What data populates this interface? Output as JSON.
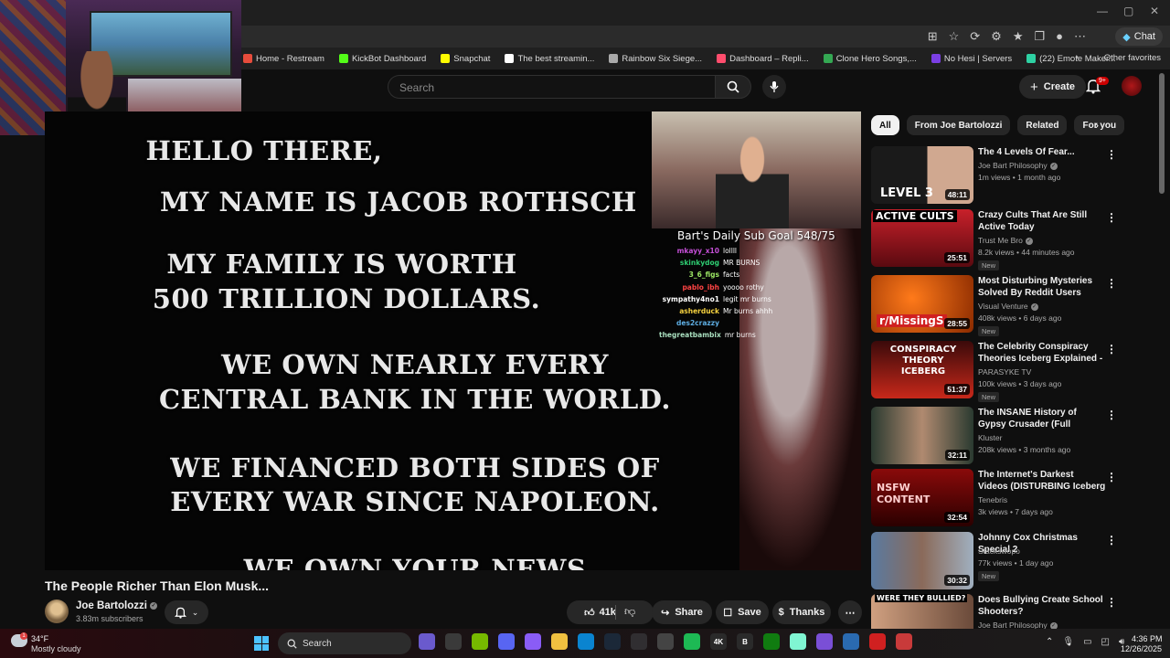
{
  "browser": {
    "chat_label": "Chat",
    "bookmarks": [
      {
        "label": "Home - Restream",
        "color": "#e74c3c"
      },
      {
        "label": "KickBot Dashboard",
        "color": "#53fc18"
      },
      {
        "label": "Snapchat",
        "color": "#fffc00"
      },
      {
        "label": "The best streamin...",
        "color": "#ffffff"
      },
      {
        "label": "Rainbow Six Siege...",
        "color": "#aaaaaa"
      },
      {
        "label": "Dashboard – Repli...",
        "color": "#ff4d6d"
      },
      {
        "label": "Clone Hero Songs,...",
        "color": "#34a853"
      },
      {
        "label": "No Hesi | Servers",
        "color": "#7b3fe4"
      },
      {
        "label": "(22) Emote Maker...",
        "color": "#2ed1a3"
      }
    ],
    "other_favorites": "Other favorites"
  },
  "header": {
    "search_placeholder": "Search",
    "create_label": "Create",
    "notif_count": "9+"
  },
  "video": {
    "lines": [
      "HELLO THERE,",
      "MY NAME IS JACOB ROTHSCH",
      "MY FAMILY IS WORTH",
      "500 TRILLION DOLLARS.",
      "WE OWN NEARLY EVERY",
      "CENTRAL BANK IN THE WORLD.",
      "WE FINANCED BOTH SIDES OF",
      "EVERY WAR SINCE NAPOLEON.",
      "WE OWN YOUR NEWS"
    ],
    "sub_goal": "Bart's Daily Sub Goal 548/75",
    "chat": [
      {
        "user": "mkayy_x10",
        "msg": "lollll",
        "color": "#c44fd6"
      },
      {
        "user": "skinkydog",
        "msg": "MR BURNS",
        "color": "#2ecc71"
      },
      {
        "user": "3_6_figs",
        "msg": "facts",
        "color": "#9be564"
      },
      {
        "user": "pablo_ibh",
        "msg": "yoooo rothy",
        "color": "#ff4444"
      },
      {
        "user": "sympathy4no1",
        "msg": "legit mr burns",
        "color": "#ffffff"
      },
      {
        "user": "asherduck",
        "msg": "Mr burns ahhh",
        "color": "#f4d03f"
      },
      {
        "user": "des2crazzy",
        "msg": "",
        "color": "#5dade2"
      },
      {
        "user": "thegreatbambix",
        "msg": "mr burns",
        "color": "#a9dfbf"
      }
    ],
    "title": "The People Richer Than Elon Musk...",
    "channel": "Joe Bartolozzi",
    "subscribers": "3.83m subscribers",
    "likes": "41k",
    "share": "Share",
    "save": "Save",
    "thanks": "Thanks"
  },
  "sidebar": {
    "chips": [
      "All",
      "From Joe Bartolozzi",
      "Related",
      "For you"
    ],
    "recs": [
      {
        "title": "The 4 Levels Of Fear...",
        "channel": "Joe Bart Philosophy",
        "verified": true,
        "meta": "1m views • 1 month ago",
        "duration": "48:11",
        "new": "",
        "thumb_text": "LEVEL 3",
        "thumb_bg": "linear-gradient(90deg,#1a1a1a 0 55%,#d0a890 55%)"
      },
      {
        "title": "Crazy Cults That Are Still Active Today",
        "channel": "Trust Me Bro",
        "verified": true,
        "meta": "8.2k views • 44 minutes ago",
        "duration": "25:51",
        "new": "New",
        "thumb_text": "ACTIVE CULTS",
        "thumb_bg": "linear-gradient(180deg,#c8202a,#5a0a10)"
      },
      {
        "title": "Most Disturbing Mysteries Solved By Reddit Users",
        "channel": "Visual Venture",
        "verified": true,
        "meta": "408k views • 6 days ago",
        "duration": "28:55",
        "new": "New",
        "thumb_text": "r/MissingS",
        "thumb_bg": "radial-gradient(circle at 40% 40%,#ff7a1a,#8a2a00)"
      },
      {
        "title": "The Celebrity Conspiracy Theories Iceberg Explained - ...",
        "channel": "PARASYKE TV",
        "verified": false,
        "meta": "100k views • 3 days ago",
        "duration": "51:37",
        "new": "New",
        "thumb_text": "CONSPIRACY THEORY ICEBERG",
        "thumb_bg": "linear-gradient(180deg,#3a0a0a,#c8281a)"
      },
      {
        "title": "The INSANE History of Gypsy Crusader (Full Documentary)",
        "channel": "Kluster",
        "verified": false,
        "meta": "208k views • 3 months ago",
        "duration": "32:11",
        "new": "",
        "thumb_text": "",
        "thumb_bg": "linear-gradient(90deg,#2a3a30,#b08a70,#2a3a30)"
      },
      {
        "title": "The Internet's Darkest Videos (DISTURBING Iceberg List)",
        "channel": "Tenebris",
        "verified": false,
        "meta": "3k views • 7 days ago",
        "duration": "32:54",
        "new": "",
        "thumb_text": "NSFW CONTENT",
        "thumb_bg": "linear-gradient(180deg,#8a0a0a,#2a0000)"
      },
      {
        "title": "Johnny Cox Christmas Special 2",
        "channel": "Stackswopo",
        "verified": false,
        "meta": "77k views • 1 day ago",
        "duration": "30:32",
        "new": "New",
        "thumb_text": "",
        "thumb_bg": "linear-gradient(90deg,#5a7aa0,#8a6a5a,#a0b0c0)"
      },
      {
        "title": "Does Bullying Create School Shooters?",
        "channel": "Joe Bart Philosophy",
        "verified": true,
        "meta": "",
        "duration": "",
        "new": "",
        "thumb_text": "WERE THEY BULLIED?",
        "thumb_bg": "linear-gradient(90deg,#d0a080,#6a4a3a)"
      }
    ]
  },
  "taskbar": {
    "weather_temp": "34°F",
    "weather_desc": "Mostly cloudy",
    "weather_badge": "1",
    "search_label": "Search",
    "time": "4:36 PM",
    "date": "12/26/2025",
    "apps": [
      {
        "name": "widgets-app-icon",
        "color": "#6a5acd",
        "label": ""
      },
      {
        "name": "task-view-icon",
        "color": "#3a3a3a",
        "label": ""
      },
      {
        "name": "nvidia-icon",
        "color": "#76b900",
        "label": ""
      },
      {
        "name": "discord-icon",
        "color": "#5865f2",
        "label": ""
      },
      {
        "name": "copilot-icon",
        "color": "#8a5cf6",
        "label": ""
      },
      {
        "name": "file-explorer-icon",
        "color": "#f0c040",
        "label": ""
      },
      {
        "name": "edge-icon",
        "color": "#0a84d0",
        "label": ""
      },
      {
        "name": "steam-icon",
        "color": "#1b2838",
        "label": ""
      },
      {
        "name": "obs-icon",
        "color": "#302e31",
        "label": ""
      },
      {
        "name": "settings-app-icon",
        "color": "#444444",
        "label": ""
      },
      {
        "name": "spotify-icon",
        "color": "#1db954",
        "label": ""
      },
      {
        "name": "4k-app-icon",
        "color": "#2a2a2a",
        "label": "4K"
      },
      {
        "name": "b-app-icon",
        "color": "#2a2a2a",
        "label": "B"
      },
      {
        "name": "xbox-icon",
        "color": "#107c10",
        "label": ""
      },
      {
        "name": "streamlabs-icon",
        "color": "#80f5d2",
        "label": ""
      },
      {
        "name": "visual-studio-icon",
        "color": "#7a4fd6",
        "label": ""
      },
      {
        "name": "window-app-icon",
        "color": "#2a6ab0",
        "label": ""
      },
      {
        "name": "recorder-icon",
        "color": "#d02020",
        "label": ""
      },
      {
        "name": "grid-app-icon",
        "color": "#c83a3a",
        "label": ""
      }
    ]
  }
}
